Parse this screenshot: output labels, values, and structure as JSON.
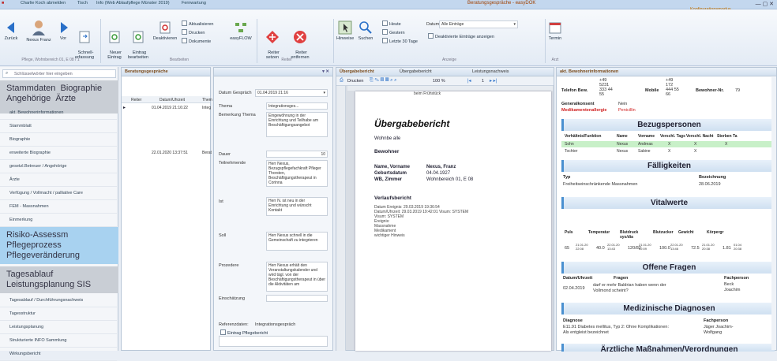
{
  "titlebar": {
    "quick1": "Charlie Koch abmelden",
    "quick2": "Tisch",
    "quick3": "Info (Web Ablaufpflege Münster 2019)",
    "quick4": "Fernwartung",
    "app_title": "Beratungsgespräche - easyDOK",
    "config": "Konfigurationsmodus"
  },
  "ribbon": {
    "zurueck": "Zurück",
    "person": "Nexus Franz",
    "vor": "Vor",
    "schnellerfassung": "Schnell-\nerfassung",
    "group1": "Pflege, Wohnbereich 01, E 08 / 1",
    "neuer_eintrag": "Neuer\nEintrag",
    "eintrag_bearbeiten": "Eintrag\nbearbeiten",
    "deaktivieren": "Deaktivieren",
    "aktualisieren": "Aktualisieren",
    "drucken": "Drucken",
    "dokumente": "Dokumente",
    "easyflow": "easyFLOW",
    "group2": "Bearbeiten",
    "reiter_setzen": "Reiter\nsetzen",
    "reiter_entfernen": "Reiter\nentfernen",
    "group3": "Reiter",
    "hinweise": "Hinweise",
    "suchen": "Suchen",
    "heute": "Heute",
    "gestern": "Gestern",
    "letzte": "Letzte 30 Tage",
    "datum_label": "Datum:",
    "datum_value": "Alle Einträge",
    "deaktivierte": "Deaktivierte Einträge anzeigen",
    "group4": "Anzeige",
    "termin": "Termin",
    "group5": "Arzt"
  },
  "nav": {
    "search_placeholder": "Schlüsselwörter hier eingeben",
    "h1": "Stammdaten  Biographie\nAngehörige  Ärzte",
    "items1": [
      "akt. Bewohnerinformationen",
      "Stammblatt",
      "Biographie",
      "erweiterte Biographie",
      "gesetzl.Betreuer / Angehörige",
      "Ärzte",
      "Verfügung / Vollmacht / palliative Care",
      "FEM - Massnahmen",
      "Einmerkung"
    ],
    "h2": "Risiko-Assessm\nPflegeprozess\nPflegeveränderung",
    "h3": "Tagesablauf\nLeistungsplanung SIS",
    "items3": [
      "Tagesablauf / Durchführungsnachweis",
      "Tagesstruktur",
      "Leistungsplanung",
      "Strukturierte INFO Sammlung",
      "Wirkungsbericht"
    ]
  },
  "list": {
    "tab": "Beratungsgespräche",
    "col1": "Reiter",
    "col2": "Datum/Uhrzeit",
    "col3": "Them",
    "row1_date": "01.04.2019 21:16:22",
    "row1_theme": "Integ",
    "row2_date": "22.01.2020 13:37:51",
    "row2_theme": "Berat"
  },
  "detail": {
    "datum_label": "Datum Gespräch",
    "datum_value": "01.04.2019 21:16",
    "thema_label": "Thema",
    "thema_value": "Integrationsges...",
    "bem_label": "Bemerkung Thema",
    "bem_value": "Eingewöhnung in der Einrichtung und Teilhabe am Beschäftigungsangebot",
    "dauer_label": "Dauer",
    "dauer_value": "10",
    "teil_label": "Teilnehmende",
    "teil_value": "Herr Nexus, Bezugspflegefachkraft Pfleger Thorsten, Beschäftigungstherapeut in Corinna",
    "ist_label": "Ist",
    "ist_value": "Herr N. ist neu in der Einrichtung und wünscht Kontakt",
    "soll_label": "Soll",
    "soll_value": "Herr Nexus schnell in die Gemeinschaft zu integrieren",
    "proz_label": "Prozedere",
    "proz_value": "Herr Nexus erhält den Veranstaltungskalender und wird tägl. von der Beschäftigungstherapeut in über die Aktivitäten am",
    "einsch_label": "Einschätzung",
    "ref_label": "Referenzdaten:",
    "ref_value": "Integrationsgespräch",
    "ref_sub": "Eintrag Pflegebericht"
  },
  "doc": {
    "tab1": "Übergabebericht",
    "tab2": "Übergabebericht",
    "tab3": "Leistungsnachweis",
    "drucken": "Drucken",
    "zoom": "100 %",
    "page": "1",
    "header_cut": "beim Frühstück",
    "title": "Übergabebericht",
    "wohnbe_label": "Wohnbe",
    "wohnbe_value": "alle",
    "bewohner": "Bewohner",
    "name_label": "Name, Vorname",
    "name_value": "Nexus, Franz",
    "geb_label": "Geburtsdatum",
    "geb_value": "04.04.1927",
    "wb_label": "WB, Zimmer",
    "wb_value": "Wohnbereich 01, E 08",
    "verlauf": "Verlaufsbericht",
    "v1": "Datum Ereignis: 29.03.2019 19:36:54",
    "v2": "Datum/Uhrzeit: 29.03.2019 19:42:01  Visum: SYSTEM",
    "v3": "Visum: SYSTEM",
    "v4": "Ereignis:",
    "v5": "Massnahme",
    "v6": "Medikament",
    "v7": "wichtiger Hinweis"
  },
  "info": {
    "tab": "akt. Bewohnerinformationen",
    "tel_label": "Telefon Bew.",
    "tel_value": "+49\n5231\n333 44\n55",
    "mobile_label": "Mobile",
    "mobile_value": "+49\n172\n444 55\n66",
    "bewnr_label": "Bewohner-Nr.",
    "bewnr_value": "79",
    "genkon_label": "Generalkonsent",
    "genkon_value": "Nein",
    "allergie_label": "Medikamentenallergie",
    "allergie_value": "Penicillin",
    "bezug_title": "Bezugspersonen",
    "bezug_headers": [
      "Verhältnis/Funktion",
      "Name",
      "Vorname",
      "Verschl. Tags",
      "Verschl. Nacht",
      "Sterben Ta"
    ],
    "bezug_rows": [
      [
        "Sohn",
        "Nexus",
        "Andreas",
        "X",
        "X",
        "X"
      ],
      [
        "Tochter",
        "Nexus",
        "Sabine",
        "X",
        "X",
        ""
      ]
    ],
    "faell_title": "Fälligkeiten",
    "faell_h1": "Typ",
    "faell_h2": "Bezeichnung",
    "faell_r1": "Freiheitseinschränkende Massnahmen",
    "faell_r1d": "28.06.2019",
    "vital_title": "Vitalwerte",
    "vital_headers": [
      "Puls",
      "Temperatur",
      "Blutdruck sys/dia",
      "Blutzucker",
      "Gewicht",
      "Körpergr"
    ],
    "vital_vals": [
      "65",
      "40.0",
      "120/82",
      "100.0",
      "72.5",
      "1.81"
    ],
    "vital_times": [
      "21.01.20\n22:08",
      "22.01.20\n13:43",
      "21.01.20\n22:09",
      "22.01.20\n13:46",
      "21.01.20\n20:38",
      "01.04\n20:38"
    ],
    "fragen_title": "Offene Fragen",
    "fragen_h1": "Datum/Uhrzeit",
    "fragen_h2": "Fragen",
    "fragen_h3": "Fachperson",
    "fragen_date": "02.04.2019",
    "fragen_text": "darf er mehr Baldrian haben wenn der Vollmond scheint?",
    "fragen_person": "Beck\nJoachim",
    "diag_title": "Medizinische Diagnosen",
    "diag_h1": "Diagnose",
    "diag_h2": "Fachperson",
    "diag_text": "E11.91 Diabetes mellitus, Typ 2: Ohne Komplikationen:\nAls entgleist bezeichnet",
    "diag_person": "Jäger Joachim-\nWolfgang",
    "cut_title": "Ärztliche Maßnahmen/Verordnungen"
  },
  "colors": {
    "accent": "#4a90d0",
    "allergy": "#d02020",
    "highlight": "#c8f0c8",
    "navblue": "#a8d2f0"
  }
}
